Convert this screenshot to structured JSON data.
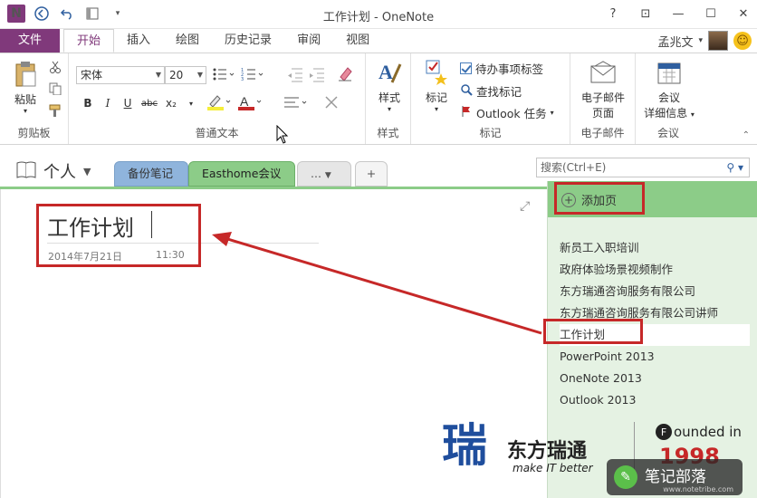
{
  "titlebar": {
    "title": "工作计划 - OneNote",
    "app_logo": "N",
    "help": "?",
    "restore": "⊡",
    "minimize": "—",
    "maximize": "☐",
    "close": "✕"
  },
  "tabs": {
    "file": "文件",
    "items": [
      "开始",
      "插入",
      "绘图",
      "历史记录",
      "审阅",
      "视图"
    ],
    "active": "开始"
  },
  "user": {
    "name": "孟兆文",
    "dropdown": "▾"
  },
  "ribbon": {
    "clipboard": {
      "paste": "粘贴",
      "label": "剪贴板"
    },
    "font": {
      "family": "宋体",
      "size": "20",
      "bold": "B",
      "italic": "I",
      "underline": "U",
      "strike": "abc",
      "subscript": "x₂",
      "label": "普通文本"
    },
    "styles": {
      "button": "样式",
      "label": "样式"
    },
    "tags": {
      "mark": "标记",
      "todo": "待办事项标签",
      "find": "查找标记",
      "outlook": "Outlook 任务",
      "label": "标记"
    },
    "email": {
      "line1": "电子邮件",
      "line2": "页面",
      "label": "电子邮件"
    },
    "meeting": {
      "line1": "会议",
      "line2": "详细信息",
      "label": "会议"
    }
  },
  "notebook": {
    "name": "个人",
    "sections": [
      "备份笔记",
      "Easthome会议",
      "...",
      "+"
    ],
    "search_placeholder": "搜索(Ctrl+E)"
  },
  "page": {
    "title": "工作计划",
    "date": "2014年7月21日",
    "time": "11:30"
  },
  "pane": {
    "add_page": "添加页",
    "pages": [
      "新员工入职培训",
      "政府体验场景视频制作",
      "东方瑞通咨询服务有限公司",
      "东方瑞通咨询服务有限公司讲师",
      "工作计划",
      "PowerPoint 2013",
      "OneNote 2013",
      "Outlook 2013"
    ],
    "selected_index": 4
  },
  "watermark": {
    "brand": "东方瑞通",
    "slogan": "make IT better",
    "founded": "ounded in",
    "year": "1998",
    "stamp": "笔记部落",
    "stamp_url": "www.notetribe.com"
  },
  "colors": {
    "accent": "#80397b",
    "section_green": "#8ccc88",
    "section_blue": "#8fb4dc",
    "annotation_red": "#c62828"
  }
}
